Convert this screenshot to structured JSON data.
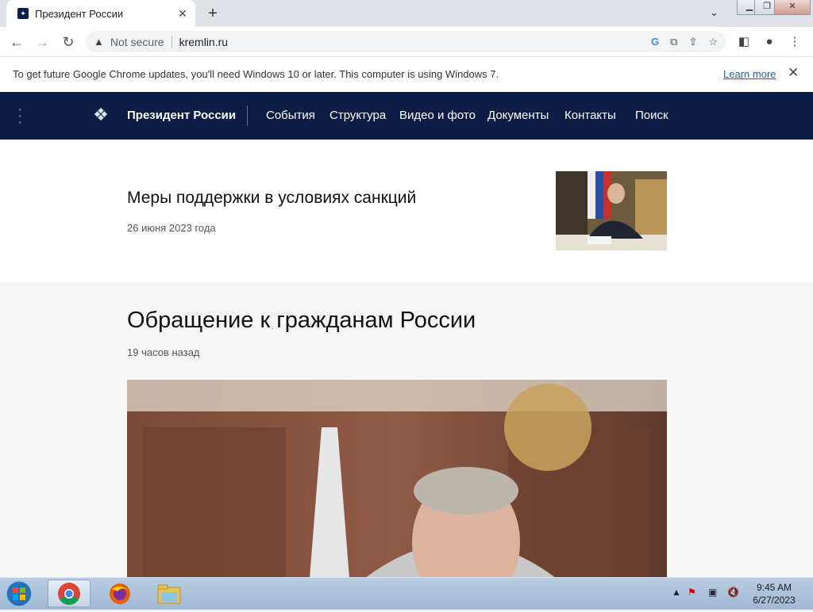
{
  "browser": {
    "tab_title": "Президент России",
    "tab_close": "✕",
    "new_tab": "+",
    "not_secure": "Not secure",
    "url": "kremlin.ru",
    "minimize": "▁",
    "restore": "❐",
    "close": "✕"
  },
  "infobar": {
    "message": "To get future Google Chrome updates, you'll need Windows 10 or later. This computer is using Windows 7.",
    "learn_more": "Learn more"
  },
  "site": {
    "brand": "Президент России",
    "nav": [
      "События",
      "Структура",
      "Видео и фото",
      "Документы",
      "Контакты",
      "Поиск"
    ]
  },
  "articles": [
    {
      "title": "Меры поддержки в условиях санкций",
      "date": "26 июня 2023 года"
    },
    {
      "title": "Обращение к гражданам России",
      "date": "19 часов назад"
    }
  ],
  "taskbar": {
    "time": "9:45 AM",
    "date": "6/27/2023"
  },
  "colors": {
    "site_nav": "#0c1c45",
    "taskbar": "#a9c1da"
  }
}
